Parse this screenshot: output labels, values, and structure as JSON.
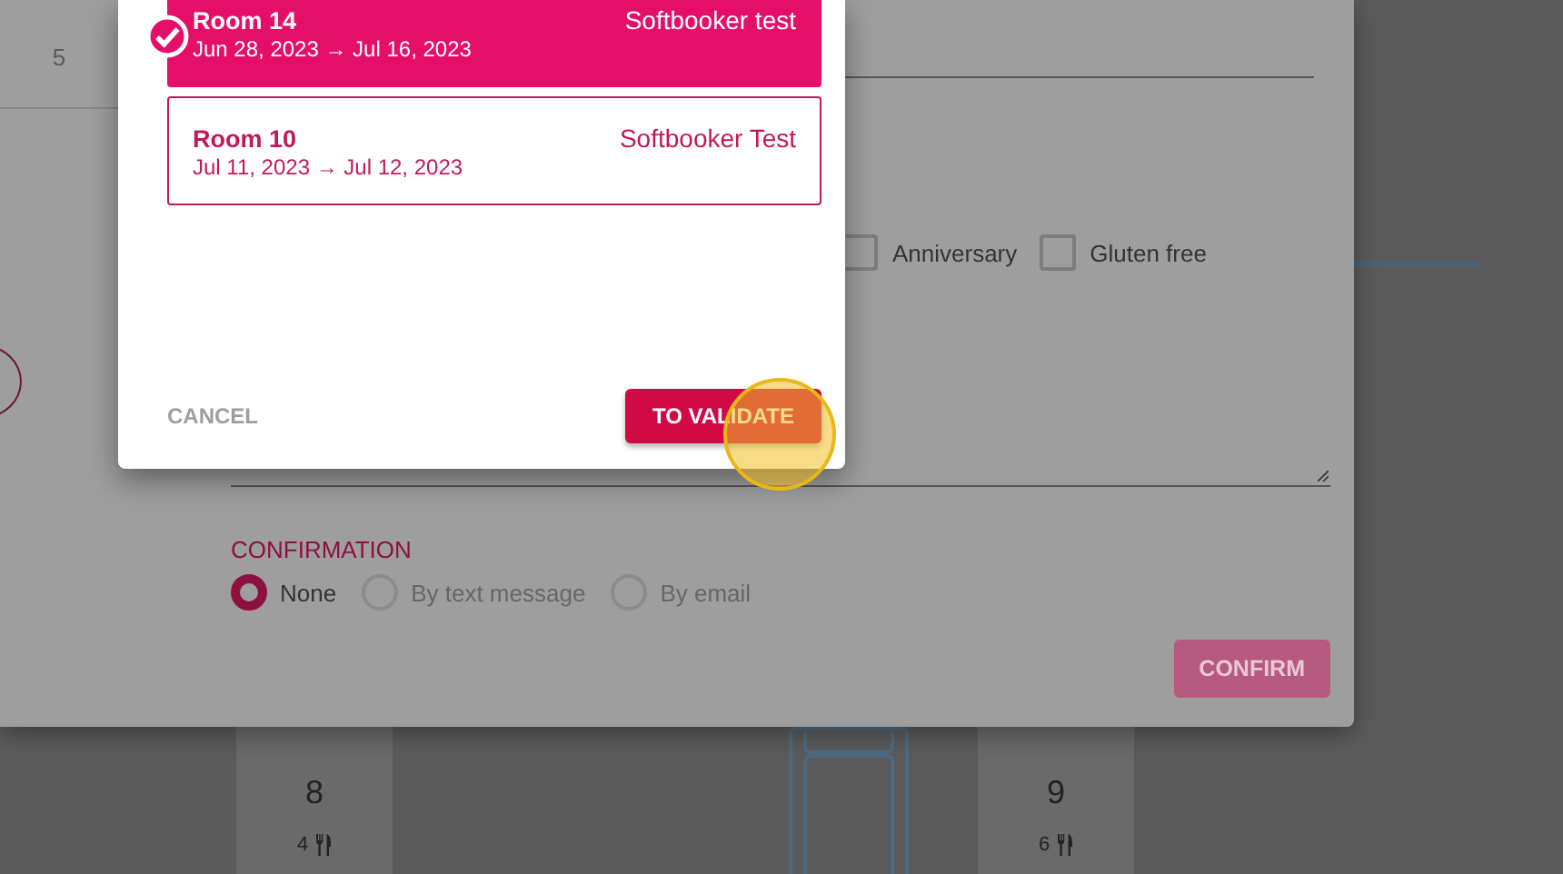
{
  "step": "5",
  "booking_dialog": {
    "rooms": [
      {
        "name": "Room 14",
        "dates": "Jun 28, 2023 → Jul 16, 2023",
        "company": "Softbooker test",
        "selected": true
      },
      {
        "name": "Room 10",
        "dates": "Jul 11, 2023 → Jul 12, 2023",
        "company": "Softbooker Test",
        "selected": false
      }
    ],
    "buttons": [
      {
        "label": "CANCEL",
        "kind": "text"
      },
      {
        "label": "TO VALIDATE",
        "kind": "primary"
      }
    ]
  },
  "form": {
    "options": [
      {
        "label": "Anniversary",
        "checked": false
      },
      {
        "label": "Gluten free",
        "checked": false
      }
    ],
    "confirmation": {
      "label": "CONFIRMATION",
      "choices": [
        {
          "label": "None",
          "selected": true
        },
        {
          "label": "By text message",
          "selected": false
        },
        {
          "label": "By email",
          "selected": false
        }
      ]
    },
    "confirm_button": "CONFIRM"
  },
  "floor_plan": {
    "tables": [
      {
        "number": "8",
        "seats": "4"
      },
      {
        "number": "9",
        "seats": "6"
      }
    ]
  }
}
